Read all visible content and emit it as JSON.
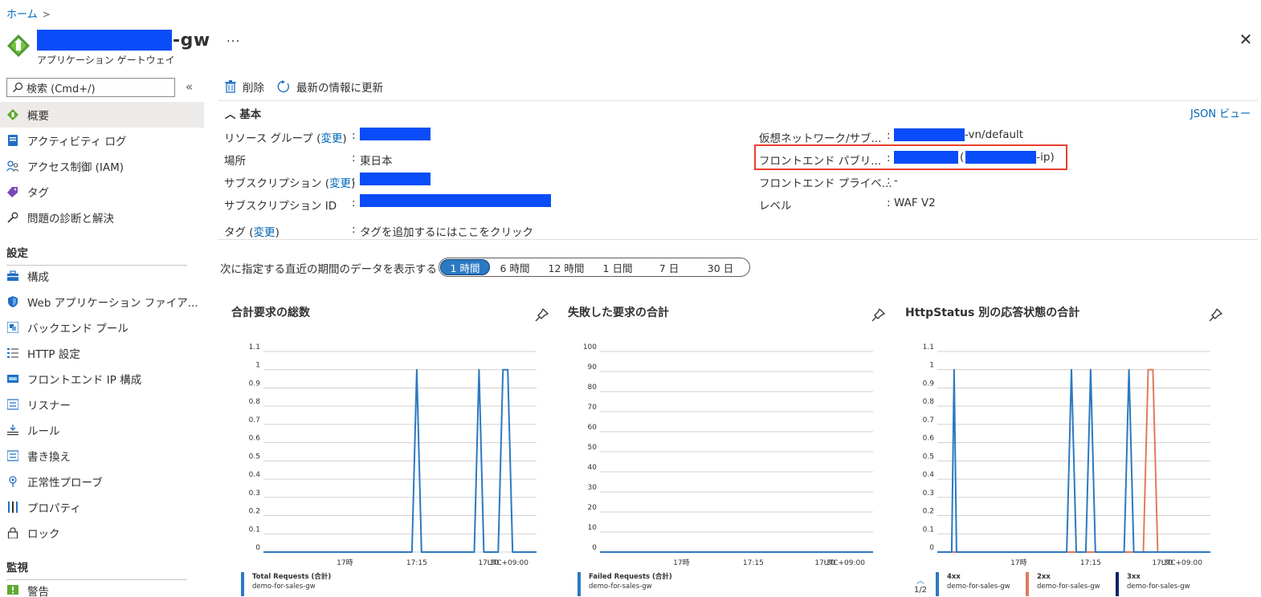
{
  "breadcrumb": {
    "home": "ホーム",
    "sep": ">"
  },
  "header": {
    "title_suffix": "-gw",
    "subtitle": "アプリケーション ゲートウェイ",
    "more": "...",
    "close": "✕"
  },
  "sidebar": {
    "search_placeholder": "検索 (Cmd+/)",
    "collapse": "«",
    "items_top": [
      {
        "label": "概要",
        "icon": "overview-icon"
      },
      {
        "label": "アクティビティ ログ",
        "icon": "activity-log-icon"
      },
      {
        "label": "アクセス制御 (IAM)",
        "icon": "iam-icon"
      },
      {
        "label": "タグ",
        "icon": "tag-icon"
      },
      {
        "label": "問題の診断と解決",
        "icon": "wrench-icon"
      }
    ],
    "section_settings": "設定",
    "items_settings": [
      {
        "label": "構成",
        "icon": "configuration-icon"
      },
      {
        "label": "Web アプリケーション ファイア...",
        "icon": "waf-shield-icon"
      },
      {
        "label": "バックエンド プール",
        "icon": "backend-pool-icon"
      },
      {
        "label": "HTTP 設定",
        "icon": "http-settings-icon"
      },
      {
        "label": "フロントエンド IP 構成",
        "icon": "frontend-ip-icon"
      },
      {
        "label": "リスナー",
        "icon": "listener-icon"
      },
      {
        "label": "ルール",
        "icon": "rules-icon"
      },
      {
        "label": "書き換え",
        "icon": "rewrite-icon"
      },
      {
        "label": "正常性プローブ",
        "icon": "health-probe-icon"
      },
      {
        "label": "プロパティ",
        "icon": "properties-icon"
      },
      {
        "label": "ロック",
        "icon": "lock-icon"
      }
    ],
    "section_monitoring": "監視",
    "items_monitoring": [
      {
        "label": "警告",
        "icon": "alert-icon"
      }
    ]
  },
  "toolbar": {
    "delete": "削除",
    "refresh": "最新の情報に更新"
  },
  "essentials": {
    "heading": "基本",
    "json_view": "JSON ビュー",
    "colon": ":",
    "resource_group_label": "リソース グループ",
    "change": "変更",
    "location_label": "場所",
    "location_value": "東日本",
    "subscription_label": "サブスクリプション",
    "subscription_id_label": "サブスクリプション ID",
    "tags_label": "タグ",
    "tags_value": "タグを追加するにはここをクリック",
    "vnet_label": "仮想ネットワーク/サブ...",
    "vnet_suffix": "-vn/default",
    "frontend_public_label": "フロントエンド パブリ...",
    "frontend_public_suffix": "-ip)",
    "paren_open": "(",
    "frontend_private_label": "フロントエンド プライベ...",
    "frontend_private_value": "-",
    "tier_label": "レベル",
    "tier_value": "WAF V2"
  },
  "time_range": {
    "label": "次に指定する直近の期間のデータを表示する",
    "options": [
      "1 時間",
      "6 時間",
      "12 時間",
      "1 日間",
      "7 日",
      "30 日"
    ],
    "selected": "1 時間"
  },
  "colors": {
    "blue": "#2b79c2",
    "orange": "#e07a5f",
    "navy": "#10206b",
    "highlight": "#e8402c"
  },
  "chart_data": [
    {
      "type": "line",
      "title": "合計要求の総数",
      "x_ticks": [
        "17時",
        "17:15",
        "17:30",
        "UTC+09:00"
      ],
      "ylim": [
        0,
        1.1
      ],
      "y_ticks": [
        "1.1",
        "1",
        "0.9",
        "0.8",
        "0.7",
        "0.6",
        "0.5",
        "0.4",
        "0.3",
        "0.2",
        "0.1",
        "0"
      ],
      "x_range_minutes": [
        -17,
        40
      ],
      "series": [
        {
          "name": "Total Requests (合計)",
          "subtitle": "demo-for-sales-gw",
          "color": "#2b79c2",
          "points": [
            [
              -17,
              0
            ],
            [
              14,
              0
            ],
            [
              15,
              1
            ],
            [
              16,
              0
            ],
            [
              27,
              0
            ],
            [
              28,
              1
            ],
            [
              29,
              0
            ],
            [
              32,
              0
            ],
            [
              33,
              1
            ],
            [
              34,
              1
            ],
            [
              35,
              0
            ],
            [
              40,
              0
            ]
          ]
        }
      ]
    },
    {
      "type": "line",
      "title": "失敗した要求の合計",
      "x_ticks": [
        "17時",
        "17:15",
        "17:30",
        "UTC+09:00"
      ],
      "ylim": [
        0,
        100
      ],
      "y_ticks": [
        "100",
        "90",
        "80",
        "70",
        "60",
        "50",
        "40",
        "30",
        "20",
        "10",
        "0"
      ],
      "x_range_minutes": [
        -17,
        40
      ],
      "series": [
        {
          "name": "Failed Requests (合計)",
          "subtitle": "demo-for-sales-gw",
          "color": "#2b79c2",
          "points": [
            [
              -17,
              0
            ],
            [
              40,
              0
            ]
          ]
        }
      ]
    },
    {
      "type": "line",
      "title": "HttpStatus 別の応答状態の合計",
      "x_ticks": [
        "17時",
        "17:15",
        "17:30",
        "UTC+09:00"
      ],
      "ylim": [
        0,
        1.1
      ],
      "y_ticks": [
        "1.1",
        "1",
        "0.9",
        "0.8",
        "0.7",
        "0.6",
        "0.5",
        "0.4",
        "0.3",
        "0.2",
        "0.1",
        "0"
      ],
      "x_range_minutes": [
        -17,
        40
      ],
      "series": [
        {
          "name": "4xx",
          "subtitle": "demo-for-sales-gw",
          "color": "#2b79c2",
          "points": [
            [
              -17,
              0
            ],
            [
              -14,
              0
            ],
            [
              -13.5,
              1
            ],
            [
              -13,
              0
            ],
            [
              10,
              0
            ],
            [
              11,
              1
            ],
            [
              12,
              0
            ],
            [
              14,
              0
            ],
            [
              15,
              1
            ],
            [
              16,
              0
            ],
            [
              22,
              0
            ],
            [
              23,
              1
            ],
            [
              24,
              0
            ],
            [
              40,
              0
            ]
          ]
        },
        {
          "name": "2xx",
          "subtitle": "demo-for-sales-gw",
          "color": "#e07a5f",
          "points": [
            [
              -17,
              0
            ],
            [
              26,
              0
            ],
            [
              27,
              1
            ],
            [
              28,
              1
            ],
            [
              29,
              0
            ],
            [
              40,
              0
            ]
          ]
        },
        {
          "name": "3xx",
          "subtitle": "demo-for-sales-gw",
          "color": "#10206b",
          "points": [
            [
              -17,
              0
            ],
            [
              40,
              0
            ]
          ]
        }
      ],
      "pager": "1/2"
    }
  ]
}
